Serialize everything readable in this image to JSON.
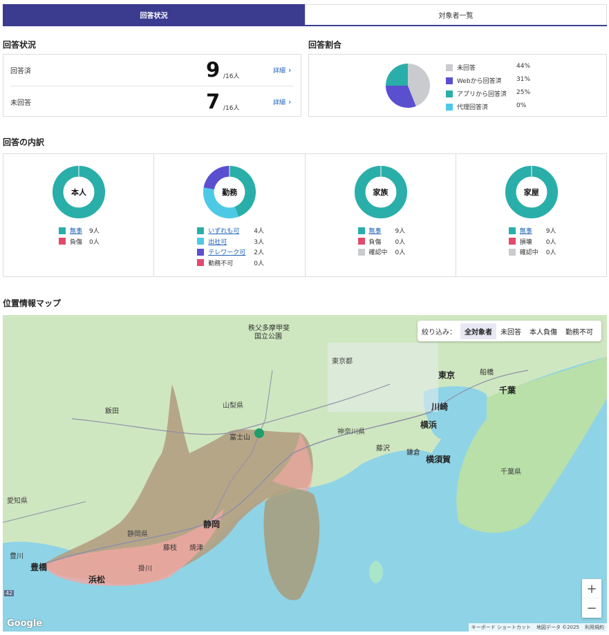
{
  "tabs": [
    {
      "label": "回答状況",
      "active": true
    },
    {
      "label": "対象者一覧",
      "active": false
    }
  ],
  "status": {
    "title": "回答状況",
    "rows": [
      {
        "label": "回答済",
        "value": "9",
        "total": "/16人",
        "link": "詳細"
      },
      {
        "label": "未回答",
        "value": "7",
        "total": "/16人",
        "link": "詳細"
      }
    ]
  },
  "ratio": {
    "title": "回答割合",
    "items": [
      {
        "label": "未回答",
        "pct": "44%",
        "color": "#c9cbcf",
        "value": 44
      },
      {
        "label": "Webから回答済",
        "pct": "31%",
        "color": "#5a4fcf",
        "value": 31
      },
      {
        "label": "アプリから回答済",
        "pct": "25%",
        "color": "#2aaea9",
        "value": 25
      },
      {
        "label": "代理回答済",
        "pct": "0%",
        "color": "#4dc9e6",
        "value": 0
      }
    ]
  },
  "breakdown": {
    "title": "回答の内訳",
    "cells": [
      {
        "center": "本人",
        "items": [
          {
            "label": "無事",
            "count": "9人",
            "color": "#2aaea9",
            "link": true,
            "value": 9
          },
          {
            "label": "負傷",
            "count": "0人",
            "color": "#e24a6d",
            "link": false,
            "value": 0
          }
        ]
      },
      {
        "center": "勤務",
        "items": [
          {
            "label": "いずれも可",
            "count": "4人",
            "color": "#2aaea9",
            "link": true,
            "value": 4
          },
          {
            "label": "出社可",
            "count": "3人",
            "color": "#4dc9e6",
            "link": true,
            "value": 3
          },
          {
            "label": "テレワーク可",
            "count": "2人",
            "color": "#5a4fcf",
            "link": true,
            "value": 2
          },
          {
            "label": "勤務不可",
            "count": "0人",
            "color": "#e24a6d",
            "link": false,
            "value": 0
          }
        ]
      },
      {
        "center": "家族",
        "items": [
          {
            "label": "無事",
            "count": "9人",
            "color": "#2aaea9",
            "link": true,
            "value": 9
          },
          {
            "label": "負傷",
            "count": "0人",
            "color": "#e24a6d",
            "link": false,
            "value": 0
          },
          {
            "label": "確認中",
            "count": "0人",
            "color": "#c9cbcf",
            "link": false,
            "value": 0
          }
        ]
      },
      {
        "center": "家屋",
        "items": [
          {
            "label": "無事",
            "count": "9人",
            "color": "#2aaea9",
            "link": true,
            "value": 9
          },
          {
            "label": "損壊",
            "count": "0人",
            "color": "#e24a6d",
            "link": false,
            "value": 0
          },
          {
            "label": "確認中",
            "count": "0人",
            "color": "#c9cbcf",
            "link": false,
            "value": 0
          }
        ]
      }
    ]
  },
  "map": {
    "title": "位置情報マップ",
    "filter": {
      "label": "絞り込み：",
      "options": [
        "全対象者",
        "未回答",
        "本人負傷",
        "勤務不可"
      ],
      "selected": "全対象者"
    },
    "labels": {
      "chichibu": "秩父多摩甲斐",
      "kokuritsu": "国立公園",
      "tokyo_to": "東京都",
      "tokyo": "東京",
      "funabashi": "船橋",
      "chiba": "千葉",
      "kawasaki": "川崎",
      "yokohama": "横浜",
      "yamanashi": "山梨県",
      "fujisan": "富士山",
      "kanagawa": "神奈川県",
      "fujisawa": "藤沢",
      "kamakura": "鎌倉",
      "yokosuka": "横須賀",
      "chiba_ken": "千葉県",
      "iida": "飯田",
      "aichi": "愛知県",
      "shizuoka": "静岡",
      "shizuoka_ken": "静岡県",
      "fujieda": "藤枝",
      "yaizu": "焼津",
      "kakegawa": "掛川",
      "toyohashi": "豊橋",
      "hamamatsu": "浜松",
      "toyokawa": "豊川",
      "route": "42"
    },
    "zoom_in": "+",
    "zoom_out": "−",
    "google": "Google",
    "attribution": [
      "キーボード ショートカット",
      "地図データ ©2025",
      "利用規約"
    ]
  }
}
